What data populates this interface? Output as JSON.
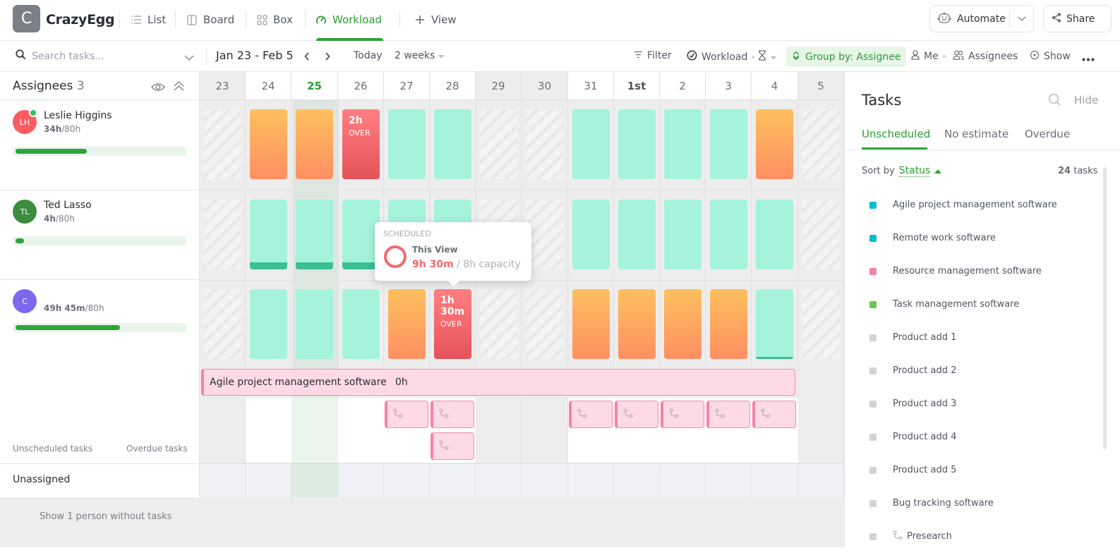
{
  "app": {
    "logo_letter": "C",
    "name": "CrazyEgg"
  },
  "views": [
    {
      "label": "List",
      "icon": "list-icon"
    },
    {
      "label": "Board",
      "icon": "board-icon"
    },
    {
      "label": "Box",
      "icon": "box-icon"
    },
    {
      "label": "Workload",
      "icon": "workload-icon",
      "active": true
    },
    {
      "label": "View",
      "icon": "plus-icon"
    }
  ],
  "header_actions": {
    "automate": "Automate",
    "share": "Share"
  },
  "toolbar": {
    "search_placeholder": "Search tasks...",
    "date_range": "Jan 23 - Feb 5",
    "today": "Today",
    "period": "2 weeks",
    "filter": "Filter",
    "workload": "Workload",
    "group_by": "Group by: Assignee",
    "me": "Me",
    "assignees": "Assignees",
    "show": "Show"
  },
  "left": {
    "title": "Assignees",
    "count": "3",
    "people": [
      {
        "initials": "LH",
        "name": "Leslie Higgins",
        "hours": "34h",
        "capacity": "/80h",
        "color": "#fd5c63",
        "online": true,
        "progress": 0.425
      },
      {
        "initials": "TL",
        "name": "Ted Lasso",
        "hours": "4h",
        "capacity": "/80h",
        "color": "#3b8c3e",
        "online": false,
        "progress": 0.05
      },
      {
        "initials": "C",
        "name": "",
        "hours": "49h 45m",
        "capacity": "/80h",
        "color": "#7b68ee",
        "online": false,
        "progress": 0.62
      }
    ],
    "unscheduled_tasks": "Unscheduled tasks",
    "overdue_tasks": "Overdue tasks",
    "unassigned": "Unassigned",
    "show_people": "Show 1 person without tasks"
  },
  "days": [
    {
      "label": "23",
      "weekend": true
    },
    {
      "label": "24"
    },
    {
      "label": "25",
      "today": true
    },
    {
      "label": "26"
    },
    {
      "label": "27"
    },
    {
      "label": "28"
    },
    {
      "label": "29",
      "weekend": true
    },
    {
      "label": "30",
      "weekend": true
    },
    {
      "label": "31"
    },
    {
      "label": "1st",
      "first": true
    },
    {
      "label": "2"
    },
    {
      "label": "3"
    },
    {
      "label": "4"
    },
    {
      "label": "5",
      "weekend": true
    }
  ],
  "workload": [
    [
      "off",
      "warn",
      "warn",
      {
        "s": "over",
        "h": "2h",
        "o": "OVER"
      },
      "ok",
      "ok",
      "off",
      "off",
      "ok",
      "ok",
      "ok",
      "ok",
      "warn",
      "off"
    ],
    [
      "off",
      {
        "s": "ok",
        "strip": 0.1
      },
      {
        "s": "ok",
        "strip": 0.1
      },
      {
        "s": "ok",
        "strip": 0.1
      },
      "ok",
      "ok",
      "off",
      "off",
      "ok",
      "ok",
      "ok",
      "ok",
      "ok",
      "off"
    ],
    [
      "off",
      "ok",
      "ok",
      "ok",
      "warn",
      {
        "s": "over",
        "h": "1h 30m",
        "o": "OVER"
      },
      "off",
      "off",
      "warn",
      "warn",
      "warn",
      "warn",
      {
        "s": "ok",
        "strip": 0.03
      },
      "off"
    ]
  ],
  "task_bar": {
    "name": "Agile project management software",
    "hours": "0h"
  },
  "subtask_cells": [
    [
      4,
      0
    ],
    [
      5,
      0
    ],
    [
      5,
      1
    ],
    [
      8,
      0
    ],
    [
      9,
      0
    ],
    [
      10,
      0
    ],
    [
      11,
      0
    ],
    [
      12,
      0
    ]
  ],
  "tooltip": {
    "label": "SCHEDULED",
    "view": "This View",
    "scheduled": "9h 30m",
    "capacity": "/ 8h capacity"
  },
  "tasks_panel": {
    "title": "Tasks",
    "hide": "Hide",
    "tabs": [
      "Unscheduled",
      "No estimate",
      "Overdue"
    ],
    "active_tab": 0,
    "sort_label": "Sort by",
    "sort_field": "Status",
    "count": "24",
    "count_suffix": "tasks",
    "items": [
      {
        "name": "Agile project management software",
        "color": "#00bcd4"
      },
      {
        "name": "Remote work software",
        "color": "#00bcd4"
      },
      {
        "name": "Resource management software",
        "color": "#f781a9"
      },
      {
        "name": "Task management software",
        "color": "#6bc950"
      },
      {
        "name": "Product add 1",
        "color": "#d3d3d3"
      },
      {
        "name": "Product add 2",
        "color": "#d3d3d3"
      },
      {
        "name": "Product add 3",
        "color": "#d3d3d3"
      },
      {
        "name": "Product add 4",
        "color": "#d3d3d3"
      },
      {
        "name": "Product add 5",
        "color": "#d3d3d3"
      },
      {
        "name": "Bug tracking software",
        "color": "#d3d3d3"
      },
      {
        "name": "Presearch",
        "color": "#d3d3d3",
        "subtask": true
      }
    ]
  }
}
